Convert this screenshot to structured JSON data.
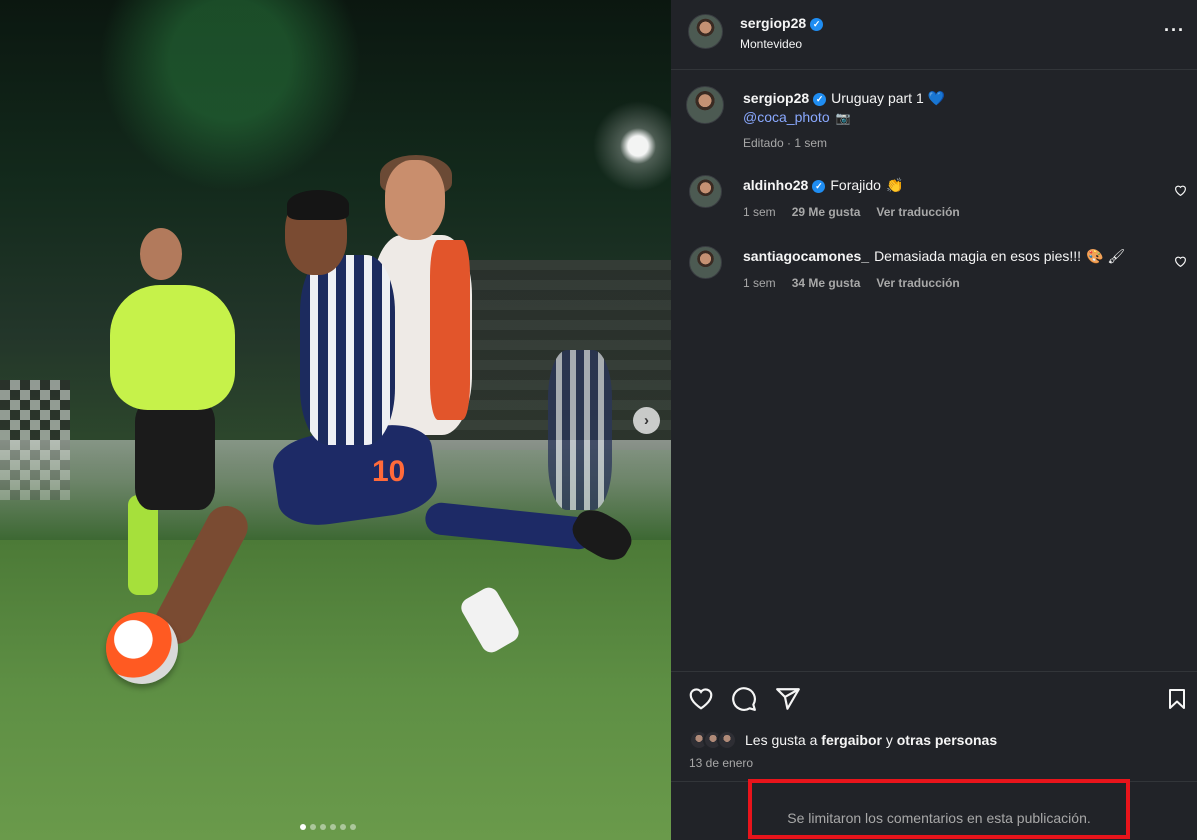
{
  "post": {
    "author": {
      "username": "sergiop28",
      "verified": true,
      "location": "Montevideo"
    },
    "caption": {
      "username": "sergiop28",
      "text": "Uruguay part 1",
      "emoji": "💙",
      "mention": "@coca_photo",
      "mention_emoji": "📷",
      "meta": "Editado · 1 sem"
    },
    "comments": [
      {
        "username": "aldinho28",
        "verified": true,
        "text": "Forajido",
        "emoji": "👏",
        "time": "1 sem",
        "likes": "29 Me gusta",
        "translate": "Ver traducción"
      },
      {
        "username": "santiagocamones_",
        "verified": false,
        "text": "Demasiada magia en esos pies!!!",
        "emoji": "🎨 🖌",
        "time": "1 sem",
        "likes": "34 Me gusta",
        "translate": "Ver traducción"
      }
    ],
    "likes": {
      "prefix": "Les gusta a",
      "user": "fergaibor",
      "connector": "y",
      "others": "otras personas"
    },
    "date": "13 de enero",
    "comments_limited": "Se limitaron los comentarios en esta publicación.",
    "carousel": {
      "total_slides": 6,
      "active_index": 0,
      "next_icon": "chevron-right-icon"
    },
    "photo": {
      "jersey_number": "10"
    }
  },
  "colors": {
    "background": "#212328",
    "verified": "#1f8df2",
    "mention": "#8aa9ff",
    "highlight_box": "#e8141b"
  },
  "icons": {
    "more": "more-horizontal-icon",
    "like": "heart-icon",
    "comment": "comment-icon",
    "share": "send-icon",
    "save": "bookmark-icon"
  }
}
